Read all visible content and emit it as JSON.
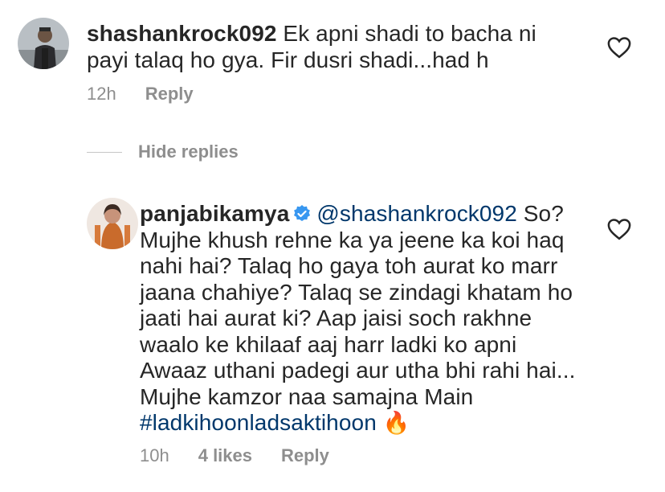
{
  "comments": [
    {
      "username": "shashankrock092",
      "text": " Ek apni shadi to bacha ni payi talaq ho gya. Fir dusri shadi...had h",
      "time": "12h",
      "reply_label": "Reply"
    },
    {
      "username": "panjabikamya",
      "verified": true,
      "mention": "@shashankrock092",
      "text": " So? Mujhe khush rehne ka ya jeene ka koi haq nahi hai? Talaq ho gaya toh aurat ko marr jaana chahiye? Talaq se zindagi khatam ho jaati hai aurat ki? Aap jaisi soch rakhne waalo ke khilaaf aaj harr ladki ko apni Awaaz uthani padegi aur utha bhi rahi hai... Mujhe kamzor naa samajna Main ",
      "hashtag": "#ladkihoonladsaktihoon",
      "emoji": "🔥",
      "time": "10h",
      "likes": "4 likes",
      "reply_label": "Reply"
    }
  ],
  "hide_replies_label": "Hide replies",
  "icons": {
    "like": "heart-outline-icon",
    "verified": "verified-badge-icon"
  },
  "colors": {
    "text": "#262626",
    "muted": "#8e8e8e",
    "link": "#00376b",
    "verified": "#3897f0"
  }
}
